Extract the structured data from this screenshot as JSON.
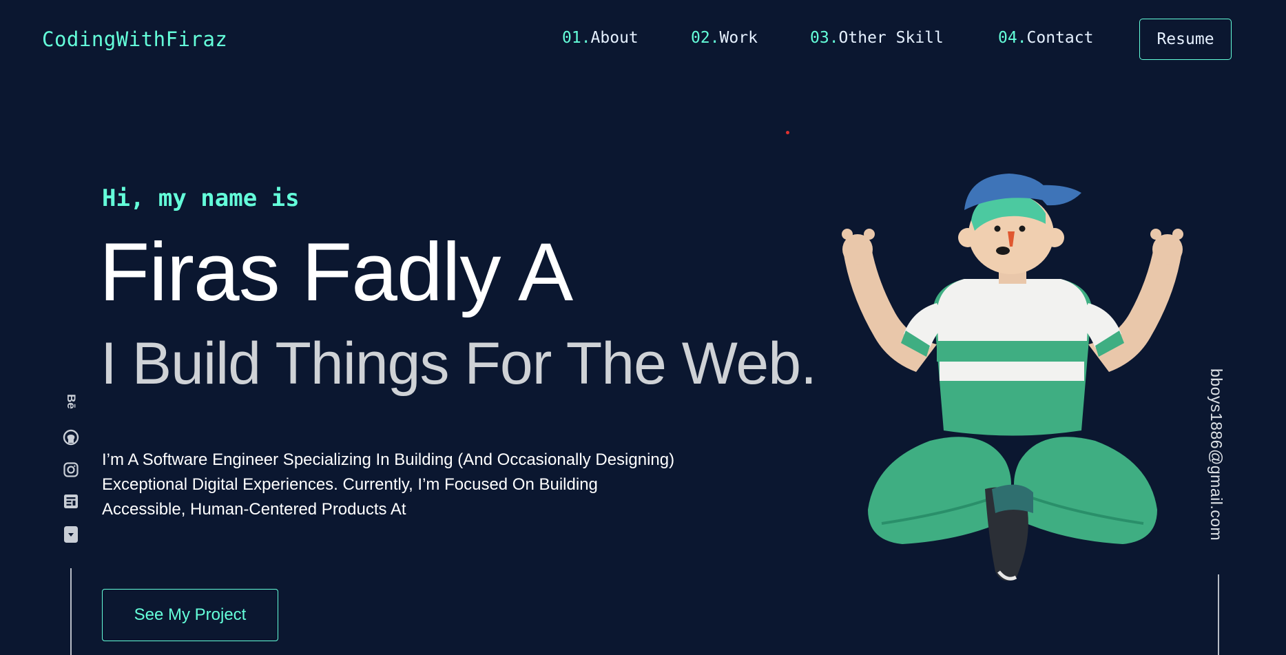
{
  "header": {
    "logo": "CodingWithFiraz",
    "nav": [
      {
        "num": "01.",
        "label": "About"
      },
      {
        "num": "02.",
        "label": "Work"
      },
      {
        "num": "03.",
        "label": "Other Skill"
      },
      {
        "num": "04.",
        "label": "Contact"
      }
    ],
    "resume_label": "Resume"
  },
  "hero": {
    "greeting": "Hi, my name is",
    "name": "Firas Fadly A",
    "tagline": "I Build Things For The Web.",
    "description_lines": [
      "I’m A Software Engineer Specializing In Building (And Occasionally Designing)",
      "Exceptional Digital Experiences. Currently, I’m Focused On Building",
      "Accessible, Human-Centered Products At"
    ],
    "cta_label": "See My Project"
  },
  "social": {
    "icons": [
      "behance-icon",
      "github-icon",
      "instagram-icon",
      "blog-icon",
      "download-icon"
    ],
    "behance_text": "Bē"
  },
  "email": "bboys1886@gmail.com",
  "colors": {
    "background": "#0b1730",
    "accent": "#64ffda",
    "heading": "#ffffff",
    "tagline": "#cfd2d6"
  }
}
